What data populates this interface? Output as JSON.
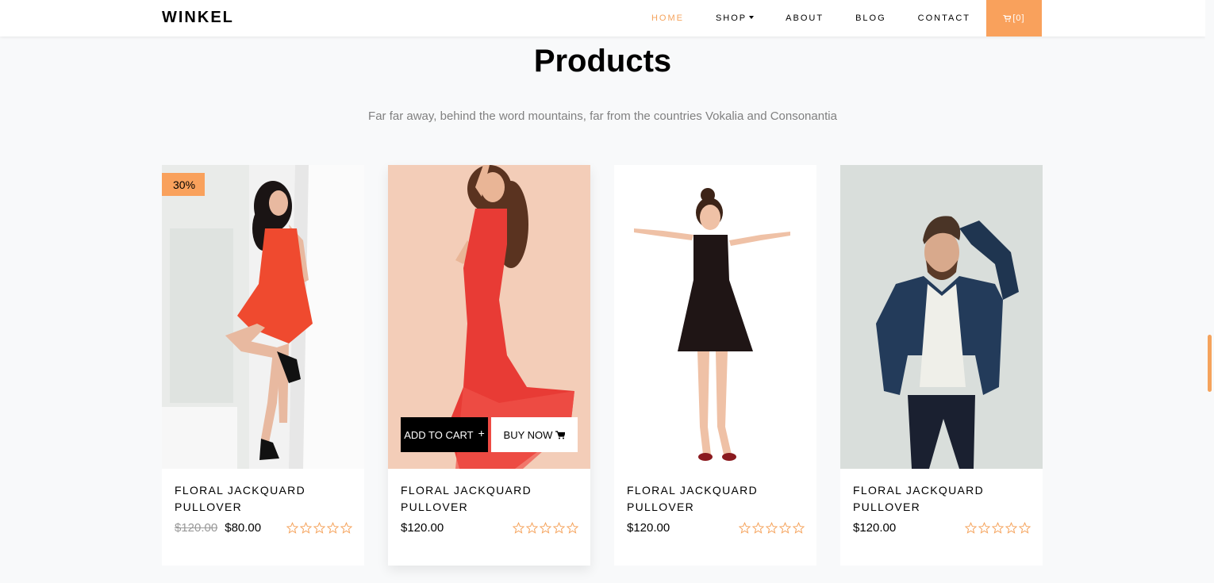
{
  "nav": {
    "brand": "WINKEL",
    "links": [
      {
        "label": "HOME",
        "active": true
      },
      {
        "label": "SHOP",
        "dropdown": true
      },
      {
        "label": "ABOUT"
      },
      {
        "label": "BLOG"
      },
      {
        "label": "CONTACT"
      }
    ],
    "cart_label": "[0]"
  },
  "colors": {
    "accent": "#f9a15c",
    "active_link": "#f5a35c",
    "background": "#f8f9fa"
  },
  "section": {
    "title": "Products",
    "subtitle": "Far far away, behind the word mountains, far from the countries Vokalia and Consonantia"
  },
  "products": [
    {
      "badge": "30%",
      "title": "Floral Jackquard Pullover",
      "old_price": "$120.00",
      "price": "$80.00",
      "rating": 0,
      "image": "woman in orange dress"
    },
    {
      "title": "Floral Jackquard Pullover",
      "price": "$120.00",
      "rating": 0,
      "image": "woman in red gown",
      "actions": {
        "add_to_cart": "ADD TO CART",
        "buy_now": "BUY NOW"
      }
    },
    {
      "title": "Floral Jackquard Pullover",
      "price": "$120.00",
      "rating": 0,
      "image": "woman in black dress"
    },
    {
      "title": "Floral Jackquard Pullover",
      "price": "$120.00",
      "rating": 0,
      "image": "man in denim jacket"
    }
  ]
}
